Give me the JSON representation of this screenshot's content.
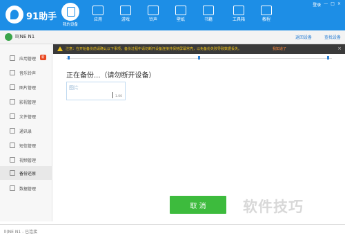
{
  "app": {
    "title": "91助手"
  },
  "window_controls": [
    "登录",
    "—",
    "□",
    "×"
  ],
  "nav": [
    {
      "label": "我的设备",
      "icon": "device-icon",
      "active": true
    },
    {
      "label": "应用",
      "icon": "apps-icon"
    },
    {
      "label": "游戏",
      "icon": "gamepad-icon"
    },
    {
      "label": "铃声",
      "icon": "music-note-icon"
    },
    {
      "label": "壁纸",
      "icon": "image-icon"
    },
    {
      "label": "书籍",
      "icon": "book-icon"
    },
    {
      "label": "工具箱",
      "icon": "toolbox-icon"
    },
    {
      "label": "教程",
      "icon": "tutorial-icon"
    }
  ],
  "device": {
    "name": "ll(NE N1",
    "tabs": [
      "返回设备",
      "查找设备"
    ]
  },
  "sidebar": {
    "items": [
      {
        "label": "应用管理",
        "icon": "app-manage-icon",
        "badge": "新"
      },
      {
        "label": "音乐铃声",
        "icon": "music-icon"
      },
      {
        "label": "图片管理",
        "icon": "photo-icon"
      },
      {
        "label": "影视管理",
        "icon": "video-icon"
      },
      {
        "label": "文件管理",
        "icon": "folder-icon"
      },
      {
        "label": "通讯录",
        "icon": "contacts-icon"
      },
      {
        "label": "短信管理",
        "icon": "sms-icon"
      },
      {
        "label": "视频管理",
        "icon": "media-icon"
      },
      {
        "label": "备份还原",
        "icon": "backup-icon",
        "active": true
      },
      {
        "label": "数据管理",
        "icon": "data-icon"
      }
    ]
  },
  "notice": {
    "text": "注意：在开始备份前请确认以下事项，备份过程中请勿断开设备连接并保持屏幕常亮，以免备份失败导致数据丢失。",
    "link": "我知道了"
  },
  "main": {
    "title": "正在备份...（请勿断开设备）",
    "box_label": "图片",
    "box_status": "1.00"
  },
  "buttons": {
    "cancel": "取 消"
  },
  "status": {
    "text": "ll(NE N1 - 已连接"
  },
  "watermark": "软件技巧",
  "colors": {
    "brand": "#1d8ee6",
    "button": "#3dbb3d",
    "notice_bg": "#3a3a3a",
    "notice_text": "#f0c419"
  }
}
